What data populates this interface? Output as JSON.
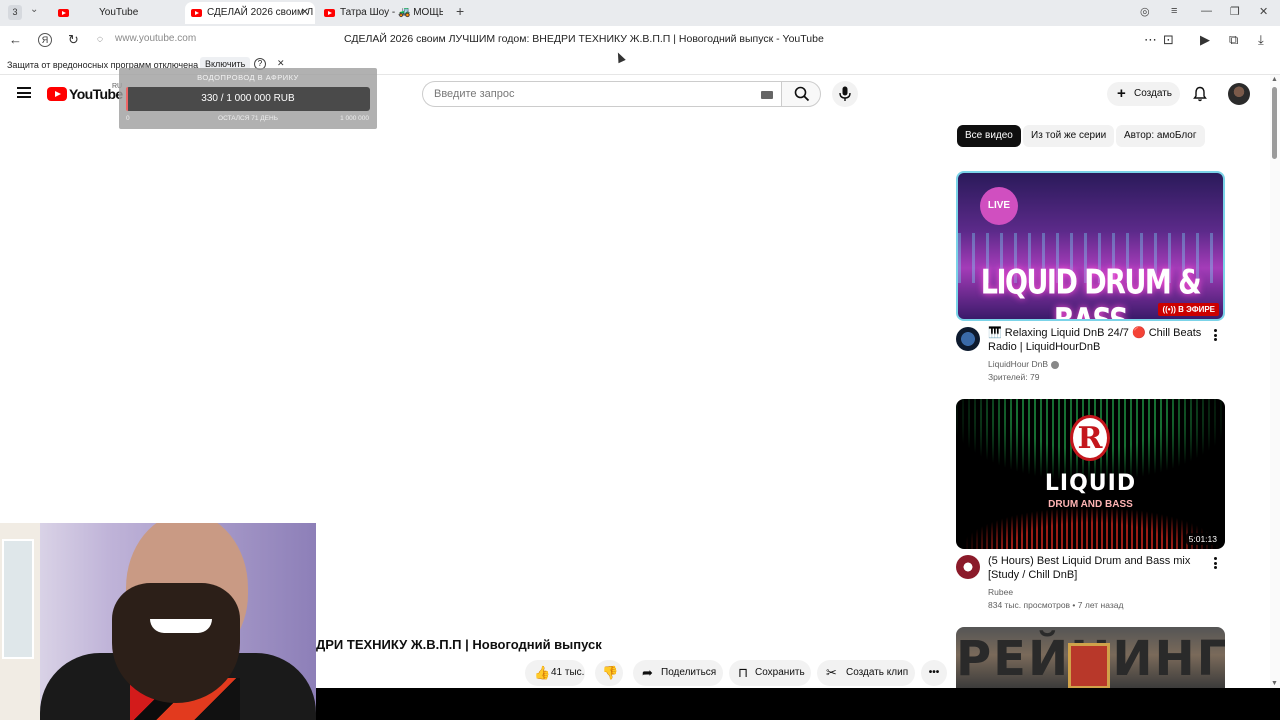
{
  "browser": {
    "tab_count": "3",
    "tabs": [
      {
        "label": "YouTube"
      },
      {
        "label": "СДЕЛАЙ 2026 своим Л"
      },
      {
        "label": "Татра Шоу - 🚜 МОЩЬ Вк"
      }
    ],
    "url": "www.youtube.com",
    "page_title": "СДЕЛАЙ 2026 своим ЛУЧШИМ годом: ВНЕДРИ ТЕХНИКУ Ж.В.П.П | Новогодний выпуск - YouTube",
    "infobar": {
      "text": "Защита от вредоносных программ отключена",
      "enable_label": "Включить"
    }
  },
  "header": {
    "logo_text": "YouTube",
    "region": "RU",
    "search_placeholder": "Введите запрос",
    "create_label": "Создать"
  },
  "donation": {
    "title": "ВОДОПРОВОД В АФРИКУ",
    "amount": "330 / 1 000 000 RUB",
    "min": "0",
    "remaining": "ОСТАЛСЯ 71 ДЕНЬ",
    "max": "1 000 000",
    "progress_fraction": 0.00033
  },
  "chips": [
    {
      "label": "Все видео",
      "active": true
    },
    {
      "label": "Из той же серии",
      "active": false
    },
    {
      "label": "Автор: амоБлог",
      "active": false
    }
  ],
  "recommendations": [
    {
      "thumb_title": "LIQUID DRUM & BASS",
      "badge": "LIVE",
      "live_label": "В ЭФИРЕ",
      "title": "🎹 Relaxing Liquid DnB 24/7 🔴 Chill Beats Radio | LiquidHourDnB",
      "channel": "LiquidHour DnB",
      "meta": "Зрителей: 79"
    },
    {
      "thumb_logo": "R",
      "thumb_title": "LIQUID",
      "thumb_subtitle": "DRUM AND BASS",
      "duration": "5:01:13",
      "title": "(5 Hours) Best Liquid Drum and Bass mix [Study / Chill DnB]",
      "channel": "Rubee",
      "meta": "834 тыс. просмотров • 7 лет назад"
    },
    {
      "thumb_title": "РЕЙНИНГ"
    }
  ],
  "video": {
    "title": "ДРИ ТЕХНИКУ Ж.В.П.П | Новогодний выпуск",
    "likes": "41 тыс.",
    "share_label": "Поделиться",
    "save_label": "Сохранить",
    "clip_label": "Создать клип"
  },
  "colors": {
    "brand_red": "#ff0000",
    "chip_active_bg": "#0f0f0f",
    "live_border": "#7bd3e8"
  }
}
